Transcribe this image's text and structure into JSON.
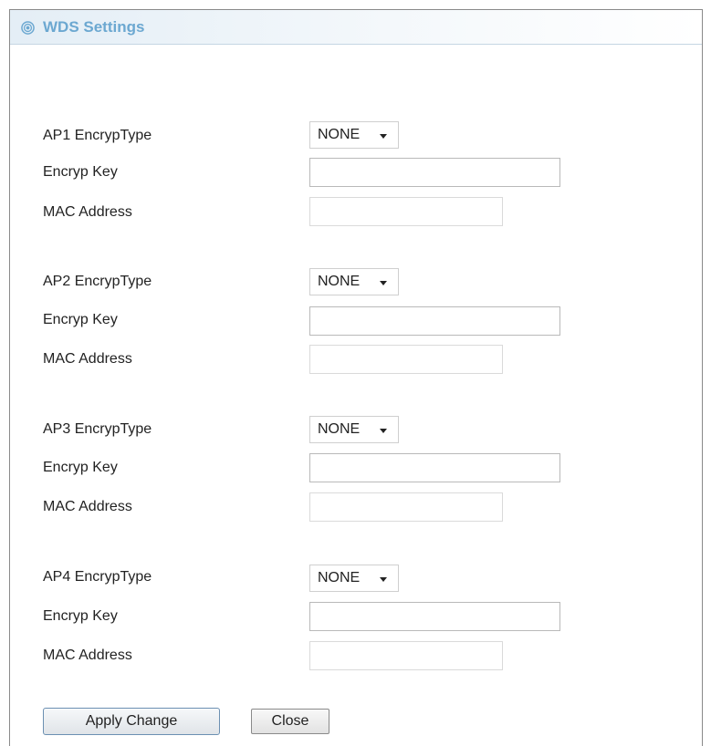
{
  "header": {
    "title": "WDS Settings",
    "icon": "target-icon",
    "accent_color": "#6ca8d1"
  },
  "aps": [
    {
      "encryp_type_label": "AP1 EncrypType",
      "encryp_type_value": "NONE",
      "encryp_key_label": "Encryp Key",
      "encryp_key_value": "",
      "mac_label": "MAC Address",
      "mac_value": ""
    },
    {
      "encryp_type_label": "AP2 EncrypType",
      "encryp_type_value": "NONE",
      "encryp_key_label": "Encryp Key",
      "encryp_key_value": "",
      "mac_label": "MAC Address",
      "mac_value": ""
    },
    {
      "encryp_type_label": "AP3 EncrypType",
      "encryp_type_value": "NONE",
      "encryp_key_label": "Encryp Key",
      "encryp_key_value": "",
      "mac_label": "MAC Address",
      "mac_value": ""
    },
    {
      "encryp_type_label": "AP4 EncrypType",
      "encryp_type_value": "NONE",
      "encryp_key_label": "Encryp Key",
      "encryp_key_value": "",
      "mac_label": "MAC Address",
      "mac_value": ""
    }
  ],
  "buttons": {
    "apply_label": "Apply Change",
    "close_label": "Close"
  }
}
